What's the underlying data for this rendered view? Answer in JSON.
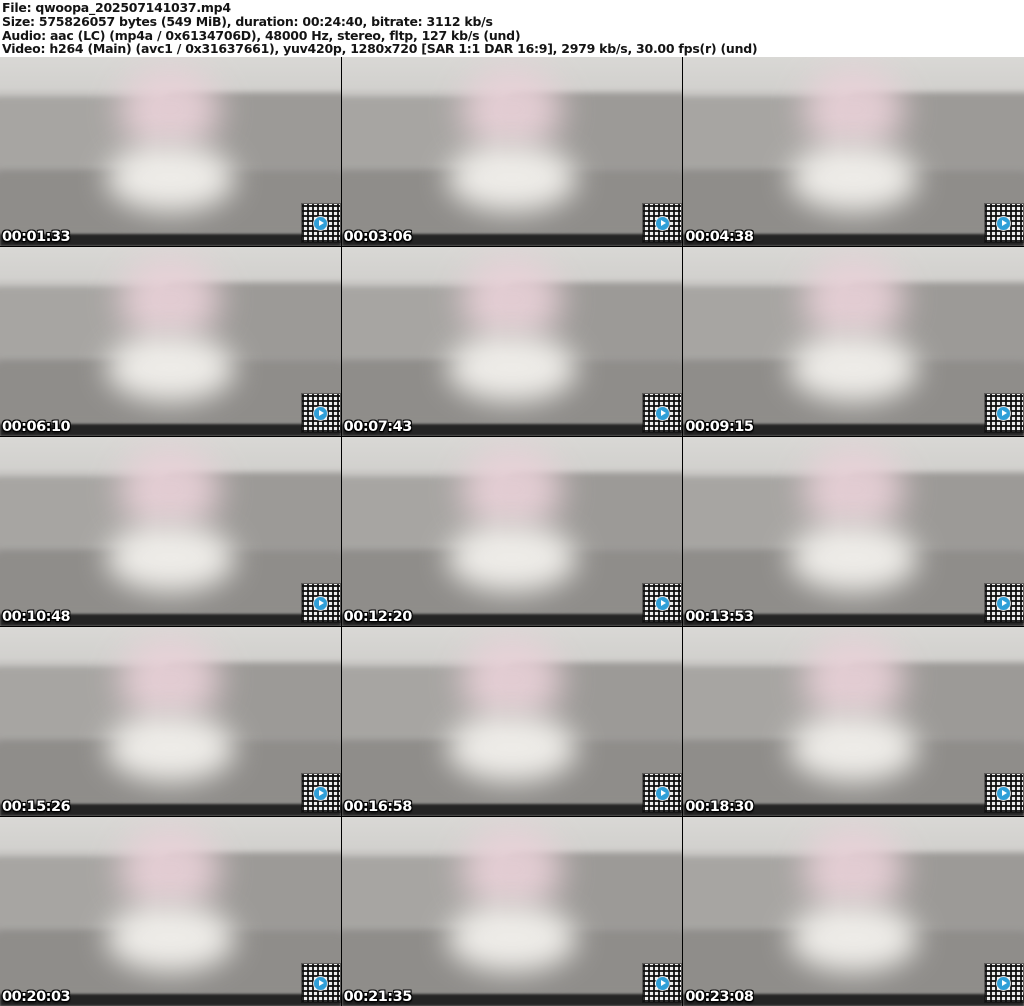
{
  "header": {
    "lines": [
      "File: qwoopa_202507141037.mp4",
      "Size: 575826057 bytes (549 MiB), duration: 00:24:40, bitrate: 3112 kb/s",
      "Audio: aac (LC) (mp4a / 0x6134706D), 48000 Hz, stereo, fltp, 127 kb/s (und)",
      "Video: h264 (Main) (avc1 / 0x31637661), yuv420p, 1280x720 [SAR 1:1 DAR 16:9], 2979 kb/s, 30.00 fps(r) (und)"
    ]
  },
  "grid": {
    "columns": 3,
    "rows": 5,
    "thumbnails": [
      {
        "timestamp": "00:01:33"
      },
      {
        "timestamp": "00:03:06"
      },
      {
        "timestamp": "00:04:38"
      },
      {
        "timestamp": "00:06:10"
      },
      {
        "timestamp": "00:07:43"
      },
      {
        "timestamp": "00:09:15"
      },
      {
        "timestamp": "00:10:48"
      },
      {
        "timestamp": "00:12:20"
      },
      {
        "timestamp": "00:13:53"
      },
      {
        "timestamp": "00:15:26"
      },
      {
        "timestamp": "00:16:58"
      },
      {
        "timestamp": "00:18:30"
      },
      {
        "timestamp": "00:20:03"
      },
      {
        "timestamp": "00:21:35"
      },
      {
        "timestamp": "00:23:08"
      }
    ]
  },
  "watermark": {
    "icon": "qr-code",
    "logo_color": "#2f9fd8"
  },
  "colors": {
    "header_bg": "#ffffff",
    "header_text": "#141414",
    "timestamp_text": "#ffffff",
    "frame_wall": "#d9d8d5",
    "frame_couch": "#9b9997",
    "frame_desk": "#242424"
  }
}
